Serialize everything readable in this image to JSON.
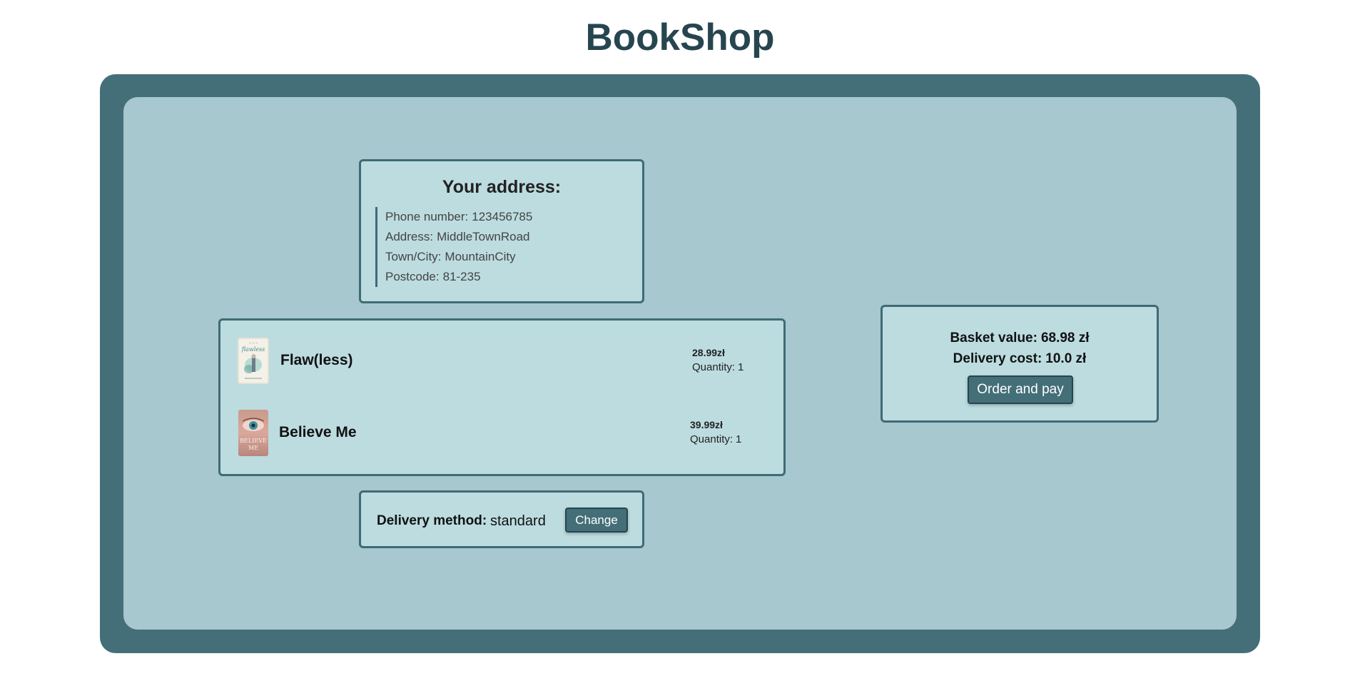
{
  "header": {
    "title": "BookShop"
  },
  "address": {
    "title": "Your address:",
    "lines": [
      {
        "label": "Phone number:",
        "value": "123456785"
      },
      {
        "label": "Address:",
        "value": "MiddleTownRoad"
      },
      {
        "label": "Town/City:",
        "value": "MountainCity"
      },
      {
        "label": "Postcode:",
        "value": "81-235"
      }
    ]
  },
  "basket": {
    "quantity_label": "Quantity:",
    "items": [
      {
        "title": "Flaw(less)",
        "price": "28.99zł",
        "quantity": "1",
        "cover_icon": "book-cover-flawless-icon"
      },
      {
        "title": "Believe Me",
        "price": "39.99zł",
        "quantity": "1",
        "cover_icon": "book-cover-believe-me-icon"
      }
    ]
  },
  "delivery": {
    "label": "Delivery method:",
    "value": "standard",
    "change_label": "Change"
  },
  "summary": {
    "basket_value_label": "Basket value:",
    "basket_value": "68.98 zł",
    "delivery_cost_label": "Delivery cost:",
    "delivery_cost": "10.0 zł",
    "order_button_label": "Order and pay"
  },
  "colors": {
    "frame": "#446f78",
    "panel": "#a6c8ce",
    "card": "#bcdce0",
    "title": "#26454f"
  }
}
